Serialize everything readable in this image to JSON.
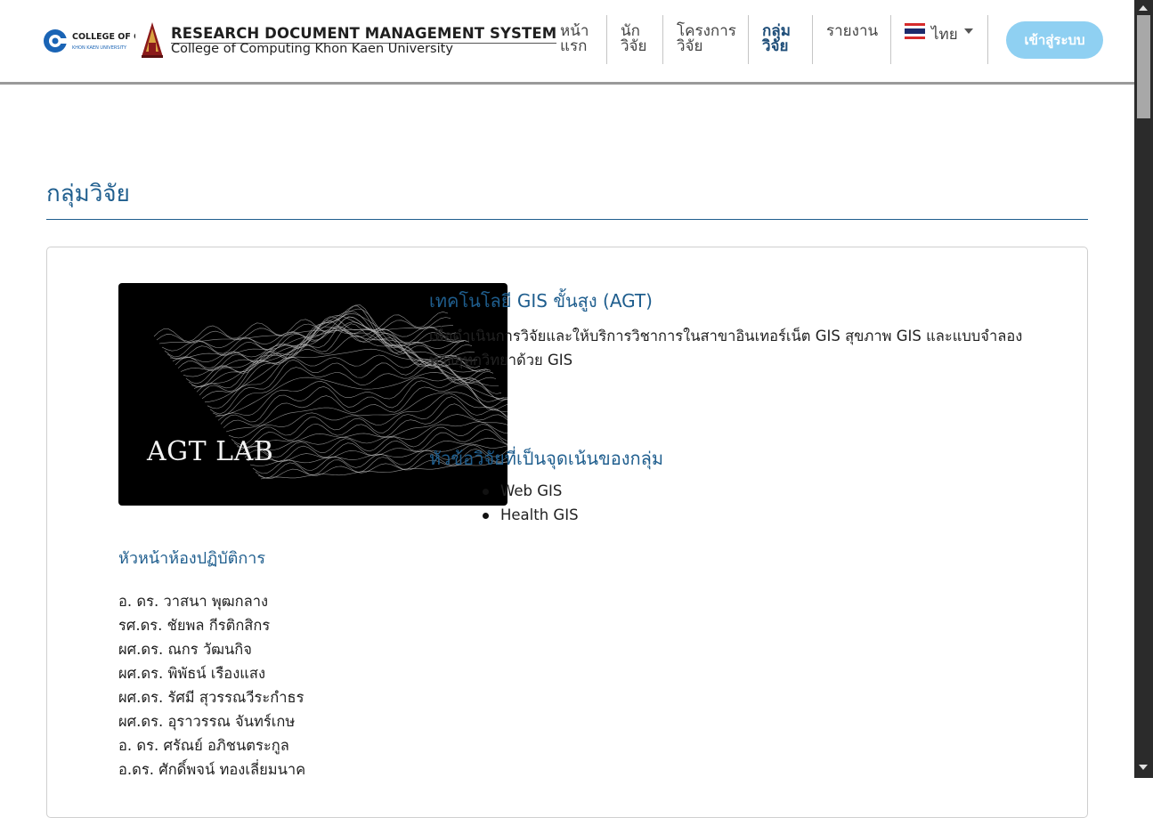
{
  "header": {
    "logo_text": "COLLEGE OF COMPUTING",
    "logo_sub": "KHON KAEN UNIVERSITY",
    "system_title": "RESEARCH DOCUMENT MANAGEMENT SYSTEM",
    "system_subtitle": "College of Computing Khon Kaen University",
    "nav": [
      {
        "line1": "หน้า",
        "line2": "แรก"
      },
      {
        "line1": "นัก",
        "line2": "วิจัย"
      },
      {
        "line1": "โครงการ",
        "line2": "วิจัย"
      },
      {
        "line1": "กลุ่ม",
        "line2": "วิจัย"
      },
      {
        "line1": "รายงาน",
        "line2": ""
      }
    ],
    "language": {
      "label": "ไทย",
      "flag_icon": "thai-flag-icon"
    },
    "login_label": "เข้าสู่ระบบ"
  },
  "page": {
    "title": "กลุ่มวิจัย"
  },
  "group": {
    "image_text": "AGT LAB",
    "name": "เทคโนโลยี GIS ขั้นสูง (AGT)",
    "description": "เพื่อดำเนินการวิจัยและให้บริการวิชาการในสาขาอินเทอร์เน็ต GIS สุขภาพ GIS และแบบจำลองทางอุทกวิทยาด้วย GIS",
    "focus_title": "หัวข้อวิจัยที่เป็นจุดเน้นของกลุ่ม",
    "focus_items": [
      "Web GIS",
      "Health GIS"
    ],
    "head_title": "หัวหน้าห้องปฏิบัติการ",
    "members": [
      "อ. ดร. วาสนา พุฒกลาง",
      "รศ.ดร. ชัยพล กีรติกสิกร",
      "ผศ.ดร. ณกร วัฒนกิจ",
      "ผศ.ดร. พิพัธน์ เรืองแสง",
      "ผศ.ดร. รัศมี สุวรรณวีระกำธร",
      "ผศ.ดร. อุราวรรณ จันทร์เกษ",
      "อ. ดร. ศรัณย์ อภิชนตระกูล",
      "อ.ดร. ศักดิ์พจน์ ทองเลี่ยมนาค"
    ]
  },
  "colors": {
    "accent": "#1f5e8e",
    "login_button": "#8fd0f2",
    "active_nav": "#1f4e79"
  }
}
